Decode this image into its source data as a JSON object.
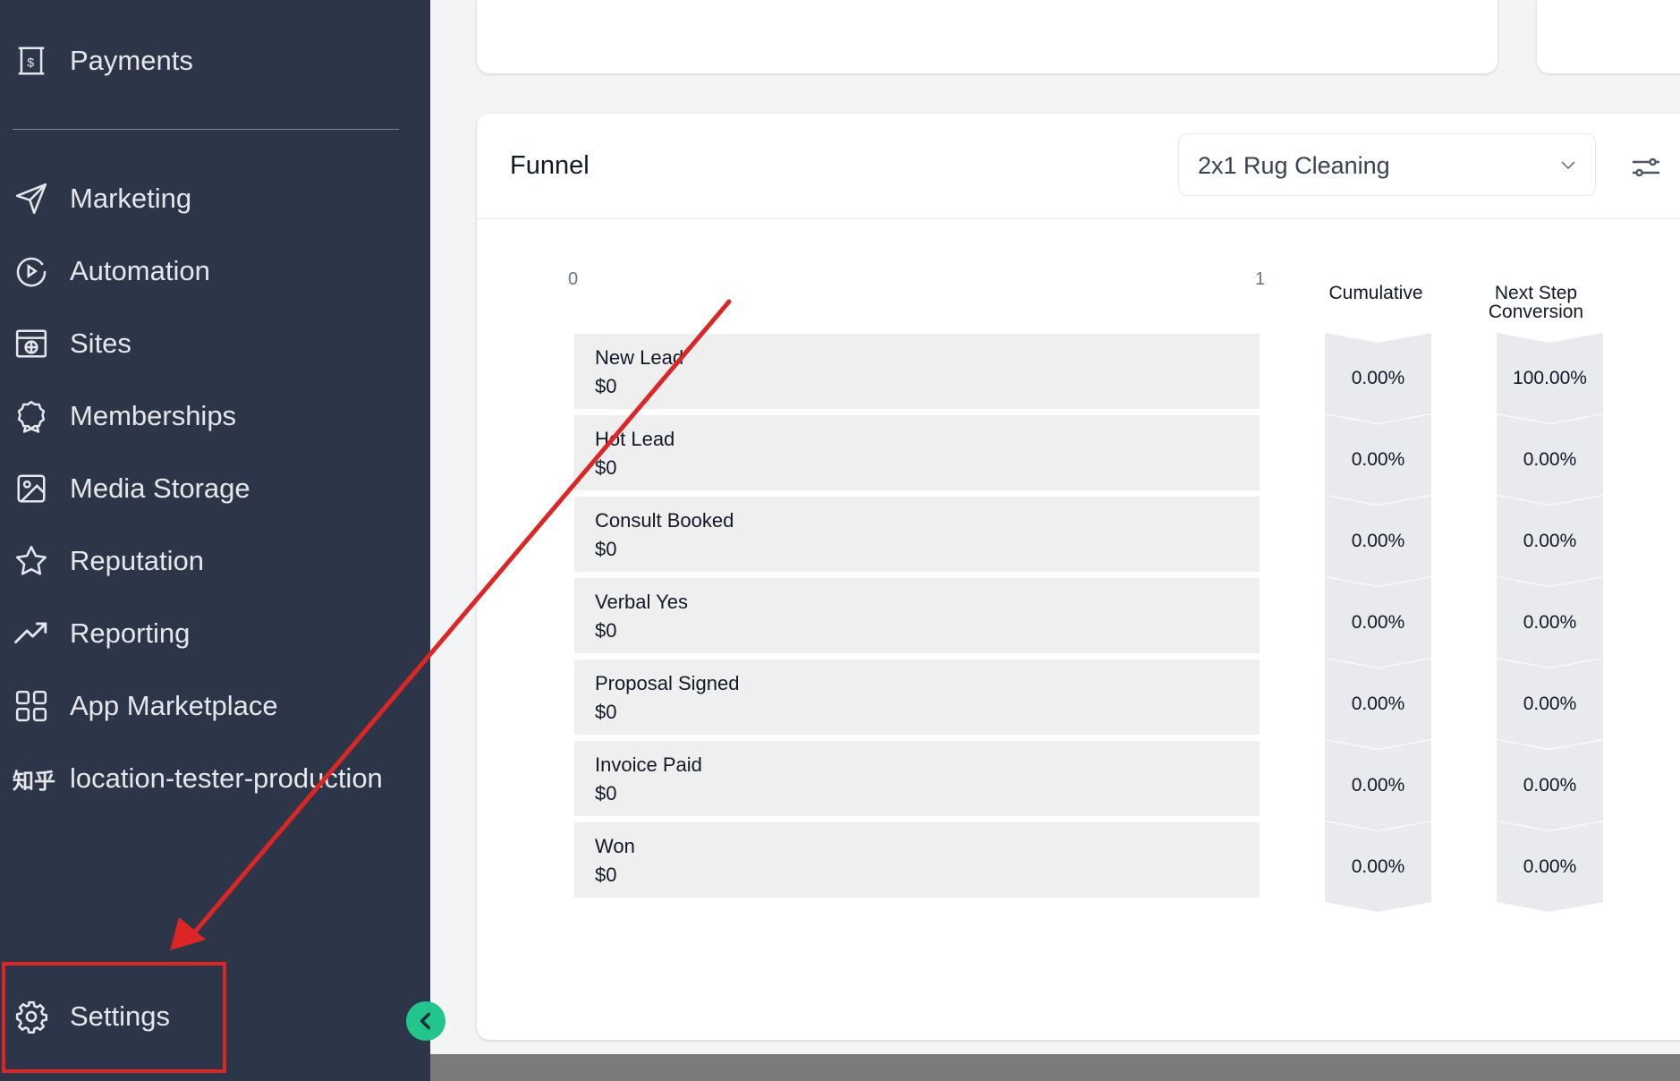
{
  "sidebar": {
    "items": [
      {
        "label": "Payments",
        "icon": "payments-icon"
      },
      {
        "label": "Marketing",
        "icon": "send-icon"
      },
      {
        "label": "Automation",
        "icon": "play-circle-icon"
      },
      {
        "label": "Sites",
        "icon": "globe-window-icon"
      },
      {
        "label": "Memberships",
        "icon": "badge-icon"
      },
      {
        "label": "Media Storage",
        "icon": "image-icon"
      },
      {
        "label": "Reputation",
        "icon": "star-icon"
      },
      {
        "label": "Reporting",
        "icon": "trending-up-icon"
      },
      {
        "label": "App Marketplace",
        "icon": "grid-icon"
      },
      {
        "label": "location-tester-production",
        "icon": "zhihu-icon",
        "icon_text": "知乎"
      }
    ],
    "settings_label": "Settings",
    "colors": {
      "background": "#2d3648",
      "text": "#e5e7eb",
      "collapse_button": "#22c58b"
    }
  },
  "funnel": {
    "title": "Funnel",
    "pipeline_selected": "2x1 Rug Cleaning",
    "axis_min": "0",
    "axis_max": "1",
    "cumulative_header": "Cumulative",
    "next_step_header_line1": "Next Step",
    "next_step_header_line2": "Conversion",
    "stages": [
      {
        "name": "New Lead",
        "value": "$0",
        "cumulative": "0.00%",
        "next_step": "100.00%"
      },
      {
        "name": "Hot Lead",
        "value": "$0",
        "cumulative": "0.00%",
        "next_step": "0.00%"
      },
      {
        "name": "Consult Booked",
        "value": "$0",
        "cumulative": "0.00%",
        "next_step": "0.00%"
      },
      {
        "name": "Verbal Yes",
        "value": "$0",
        "cumulative": "0.00%",
        "next_step": "0.00%"
      },
      {
        "name": "Proposal Signed",
        "value": "$0",
        "cumulative": "0.00%",
        "next_step": "0.00%"
      },
      {
        "name": "Invoice Paid",
        "value": "$0",
        "cumulative": "0.00%",
        "next_step": "0.00%"
      },
      {
        "name": "Won",
        "value": "$0",
        "cumulative": "0.00%",
        "next_step": "0.00%"
      }
    ]
  },
  "annotation": {
    "color": "#dc2626"
  }
}
